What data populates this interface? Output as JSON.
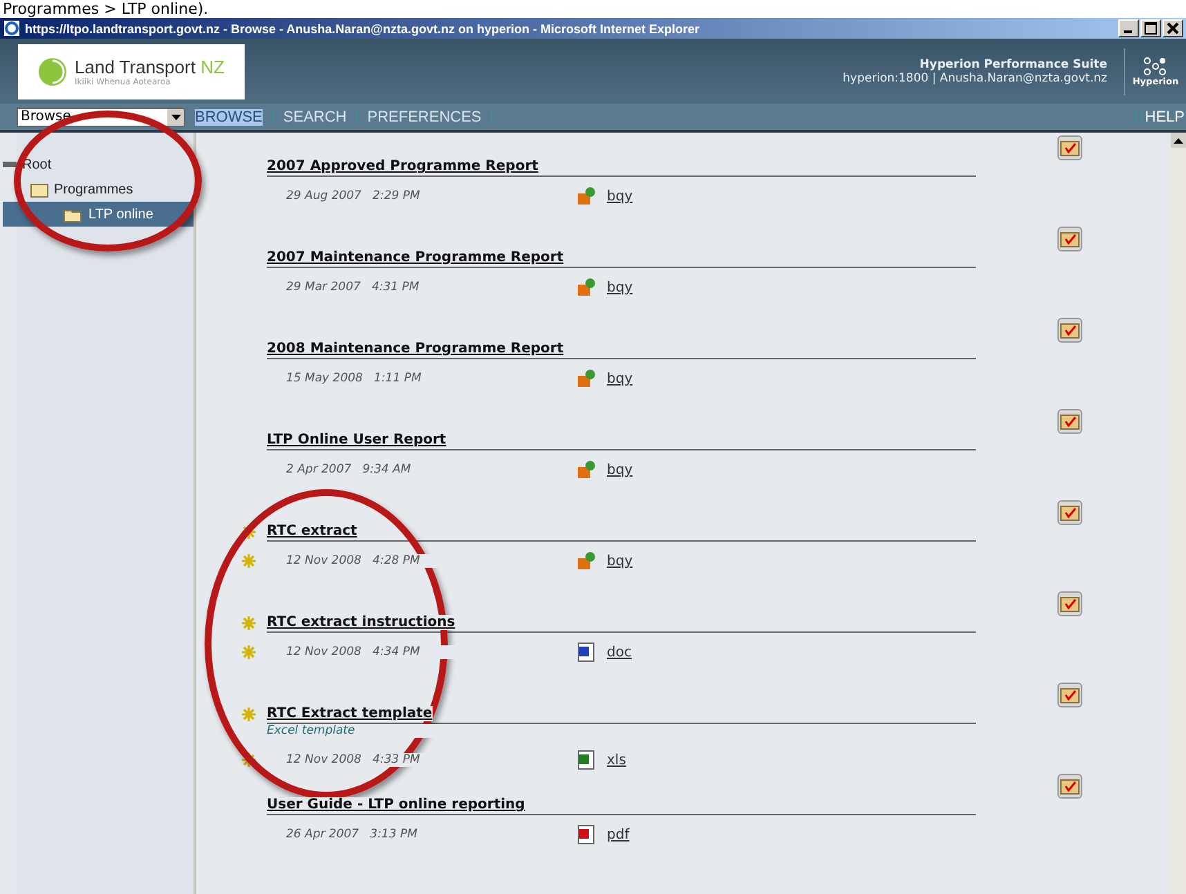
{
  "caption": "Programmes > LTP online).",
  "window": {
    "title": "https://ltpo.landtransport.govt.nz - Browse - Anusha.Naran@nzta.govt.nz on hyperion - Microsoft Internet Explorer"
  },
  "header": {
    "brand": "Land Transport",
    "brand_accent": "NZ",
    "tagline": "Ikiiki Whenua Aotearoa",
    "suite": "Hyperion Performance Suite",
    "server": "hyperion:1800 | Anusha.Naran@nzta.govt.nz",
    "vendor": "Hyperion"
  },
  "nav": {
    "mode_select": "Browse",
    "links": [
      {
        "label": "BROWSE",
        "selected": true
      },
      {
        "label": "SEARCH",
        "selected": false
      },
      {
        "label": "PREFERENCES",
        "selected": false
      }
    ],
    "help": "HELP"
  },
  "tree": [
    {
      "label": "Root",
      "selected": false,
      "children": [
        {
          "label": "Programmes",
          "selected": false,
          "children": [
            {
              "label": "LTP online",
              "selected": true
            }
          ]
        }
      ]
    }
  ],
  "items": [
    {
      "title": "2007 Approved Programme Report",
      "date": "29 Aug 2007",
      "time": "2:29 PM",
      "kind": "bqy",
      "file": "bqy",
      "new": false
    },
    {
      "title": "2007 Maintenance Programme Report",
      "date": "29 Mar 2007",
      "time": "4:31 PM",
      "kind": "bqy",
      "file": "bqy",
      "new": false
    },
    {
      "title": "2008 Maintenance Programme Report",
      "date": "15 May 2008",
      "time": "1:11 PM",
      "kind": "bqy",
      "file": "bqy",
      "new": false
    },
    {
      "title": "LTP Online User Report",
      "date": "2 Apr 2007",
      "time": "9:34 AM",
      "kind": "bqy",
      "file": "bqy",
      "new": false
    },
    {
      "title": "RTC extract",
      "date": "12 Nov 2008",
      "time": "4:28 PM",
      "kind": "bqy",
      "file": "bqy",
      "new": true
    },
    {
      "title": "RTC extract instructions",
      "date": "12 Nov 2008",
      "time": "4:34 PM",
      "kind": "doc",
      "file": "doc",
      "new": true
    },
    {
      "title": "RTC Extract template",
      "description": "Excel template",
      "date": "12 Nov 2008",
      "time": "4:33 PM",
      "kind": "xls",
      "file": "xls",
      "new": true
    },
    {
      "title": "User Guide - LTP online reporting",
      "date": "26 Apr 2007",
      "time": "3:13 PM",
      "kind": "pdf",
      "file": "pdf",
      "new": false
    }
  ]
}
